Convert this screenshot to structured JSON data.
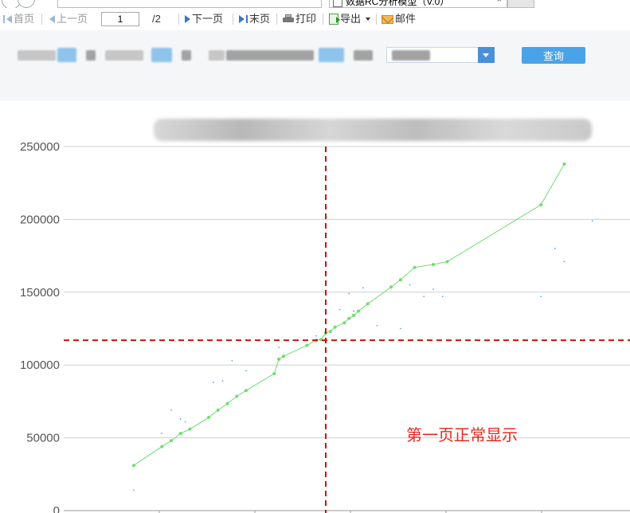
{
  "browser": {
    "tab_title": "数据RC分析模型（V.0）",
    "tab_close": "×"
  },
  "toolbar": {
    "first_label": "首页",
    "prev_label": "上一页",
    "page_value": "1",
    "page_total": "/2",
    "next_label": "下一页",
    "last_label": "末页",
    "print_label": "打印",
    "export_label": "导出",
    "mail_label": "邮件"
  },
  "params": {
    "query_label": "查询"
  },
  "colors": {
    "accent": "#4aa3e8",
    "fit_line": "#6fdc6f",
    "scatter": "#5aa7e6",
    "crosshair": "#cc1111",
    "annotation": "#e8281e"
  },
  "chart_data": {
    "type": "scatter",
    "ylim": [
      0,
      250000
    ],
    "yticks": [
      "250000",
      "200000",
      "150000",
      "100000",
      "50000",
      "0"
    ],
    "grid": true,
    "annotation": "第一页正常显示",
    "crosshair_y": 117000,
    "series": [
      {
        "kind": "fitted",
        "x": [
          1.0,
          1.3,
          1.4,
          1.5,
          1.6,
          1.8,
          1.9,
          2.0,
          2.1,
          2.2,
          2.5,
          2.55,
          2.6,
          2.85,
          2.95,
          3.0,
          3.05,
          3.1,
          3.15,
          3.25,
          3.3,
          3.35,
          3.4,
          3.5,
          3.75,
          3.85,
          4.0,
          4.2,
          4.35,
          5.35,
          5.6
        ],
        "y": [
          31000,
          44000,
          48000,
          53000,
          56000,
          64000,
          69000,
          73500,
          78500,
          82500,
          94000,
          104000,
          106000,
          113500,
          117000,
          117500,
          122000,
          123000,
          126000,
          129000,
          132000,
          134000,
          137000,
          142000,
          153500,
          158500,
          167000,
          169000,
          171000,
          210000,
          238000
        ]
      },
      {
        "kind": "actual",
        "x": [
          1.0,
          1.3,
          1.4,
          1.5,
          1.55,
          1.85,
          1.95,
          2.05,
          2.2,
          2.55,
          2.7,
          2.95,
          3.05,
          3.2,
          3.3,
          3.35,
          3.45,
          3.6,
          3.85,
          3.95,
          4.1,
          4.2,
          4.3,
          5.35,
          5.5,
          5.6,
          5.9
        ],
        "y": [
          14000,
          53000,
          69000,
          63000,
          61000,
          88000,
          89000,
          103000,
          96000,
          112000,
          117000,
          120000,
          138000,
          138000,
          149000,
          137000,
          153000,
          127000,
          125000,
          155000,
          147000,
          152000,
          147000,
          147000,
          180000,
          171000,
          199000
        ]
      }
    ]
  }
}
